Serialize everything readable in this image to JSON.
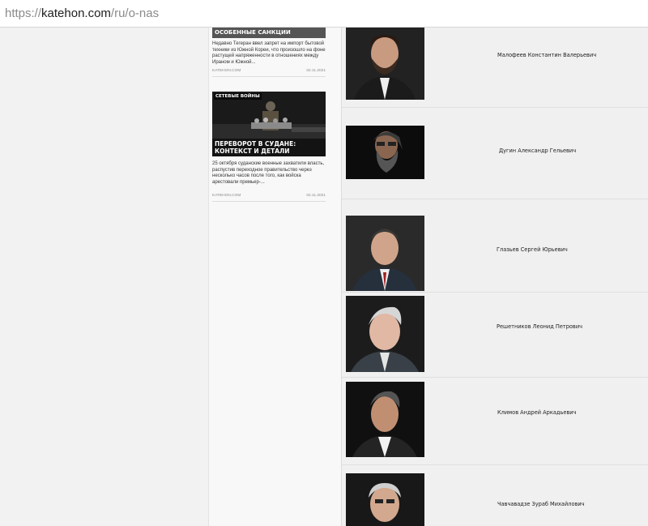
{
  "browser": {
    "url_scheme": "https://",
    "url_host": "katehon.com",
    "url_path": "/ru/o-nas"
  },
  "sidebar": {
    "cards": [
      {
        "tag": "ОСОБЕННЫЕ САНКЦИИ",
        "excerpt": "Недавно Тегеран ввел запрет на импорт бытовой техники из Южной Кореи, что произошло на фоне растущей напряженности в отношениях между Ираном и Южной...",
        "source": "KATEHON.COM",
        "date": "02.11.2021"
      },
      {
        "tag": "СЕТЕВЫЕ ВОЙНЫ",
        "title": "ПЕРЕВОРОТ В СУДАНЕ: КОНТЕКСТ И ДЕТАЛИ",
        "excerpt": "25 октября суданские военные захватили власть, распустив переходное правительство через несколько часов после того, как войска арестовали премьер-...",
        "source": "KATEHON.COM",
        "date": "02.11.2021"
      }
    ]
  },
  "people": [
    {
      "name": "Малофеев Константин Валерьевич"
    },
    {
      "name": "Дугин Александр Гельевич"
    },
    {
      "name": "Глазьев Сергей Юрьевич"
    },
    {
      "name": "Решетников Леонид Петрович"
    },
    {
      "name": "Климов Андрей Аркадьевич"
    },
    {
      "name": "Чавчавадзе Зураб Михайлович"
    }
  ]
}
